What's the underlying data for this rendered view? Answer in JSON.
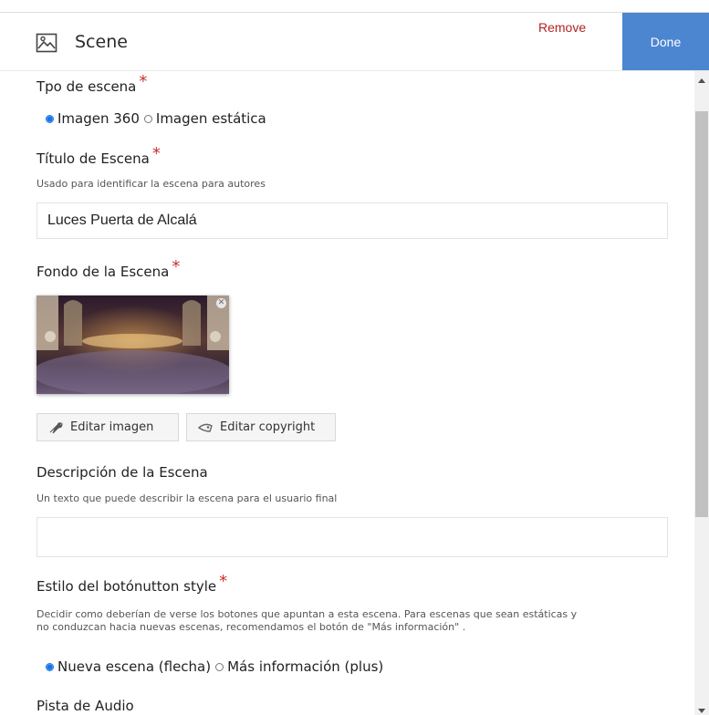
{
  "header": {
    "title": "Scene",
    "icon": "image-icon",
    "remove_label": "Remove",
    "done_label": "Done"
  },
  "scene_type": {
    "label": "Tpo de escena",
    "required_mark": "*",
    "options": [
      "Imagen 360",
      "Imagen estática"
    ],
    "selected": "Imagen 360"
  },
  "scene_title": {
    "label": "Título de Escena",
    "required_mark": "*",
    "description": "Usado para identificar la escena para autores",
    "value": "Luces Puerta de Alcalá"
  },
  "background": {
    "label": "Fondo de la Escena",
    "required_mark": "*",
    "remove_icon": "close-icon",
    "edit_image_label": "Editar imagen",
    "edit_copyright_label": "Editar copyright"
  },
  "scene_description": {
    "label": "Descripción de la Escena",
    "description": "Un texto que puede describir la escena para el usuario final",
    "value": ""
  },
  "button_style": {
    "label": "Estilo del botónutton style",
    "required_mark": "*",
    "description_line1": "Decidir como deberían de verse los botones que apuntan a esta escena. Para escenas que sean estáticas y",
    "description_line2": "no conduzcan hacia nuevas escenas, recomendamos el botón de \"Más información\" .",
    "options": [
      "Nueva escena (flecha)",
      "Más información (plus)"
    ],
    "selected": "Nueva escena (flecha)"
  },
  "audio_track": {
    "label": "Pista de Audio"
  },
  "colors": {
    "done_bg": "#4c86d1",
    "remove_text": "#b22222",
    "required": "#c9302c"
  }
}
